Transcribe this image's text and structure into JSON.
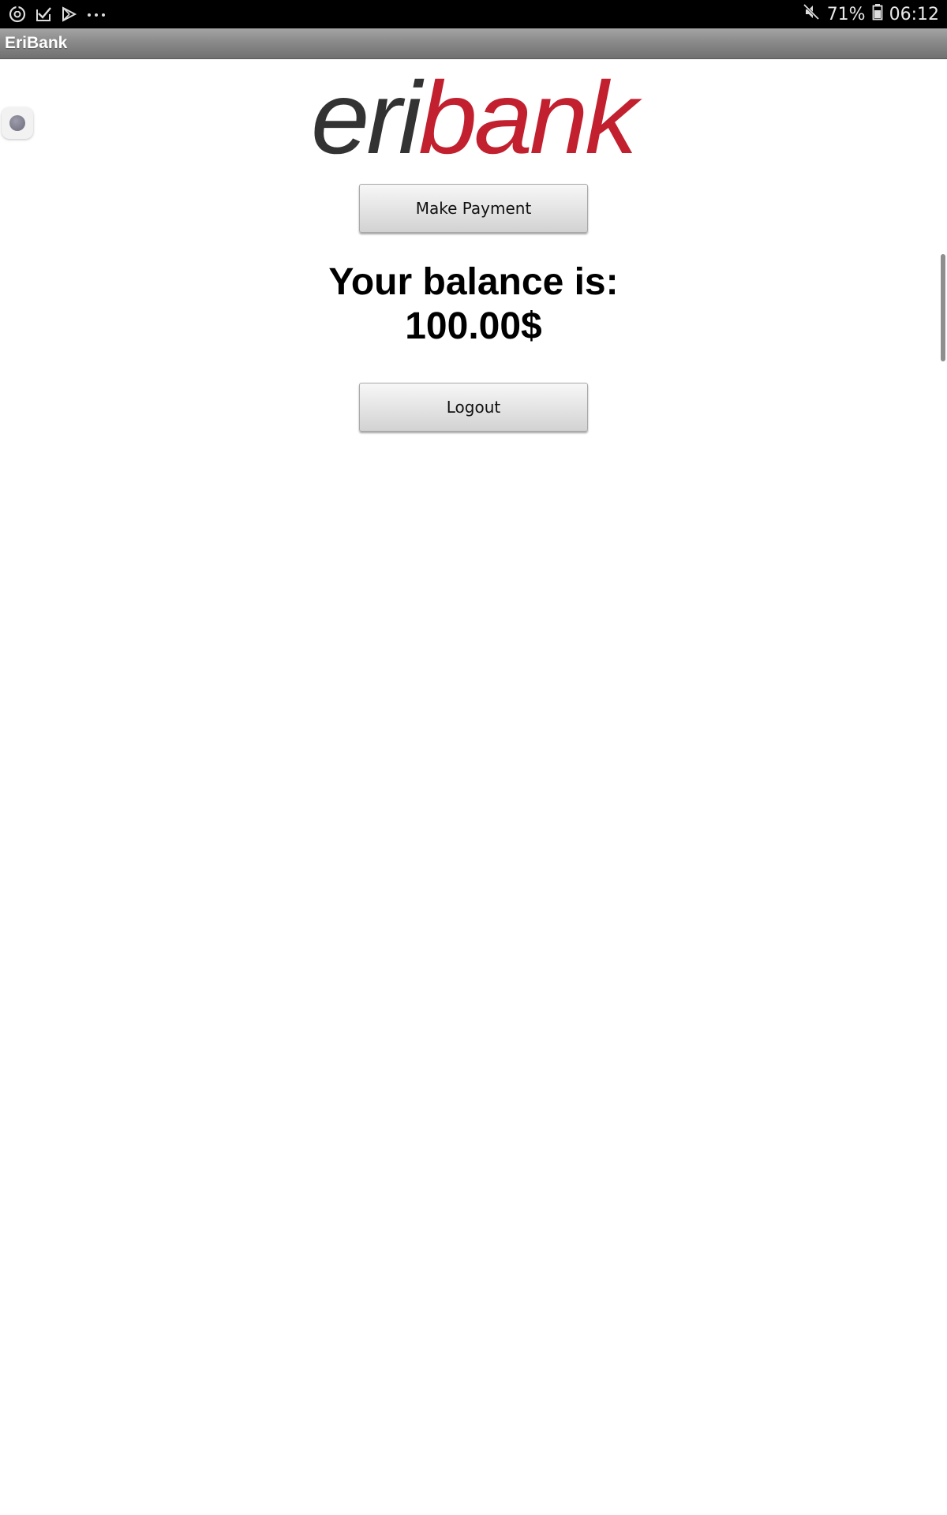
{
  "status_bar": {
    "icons": [
      "sync-icon",
      "mail-check-icon",
      "play-store-icon",
      "more-dots-icon"
    ],
    "mute_icon": "mute-icon",
    "battery_icon": "battery-icon",
    "battery": "71%",
    "time": "06:12"
  },
  "app": {
    "title": "EriBank"
  },
  "logo": {
    "text_dark": "eri",
    "text_red": "bank",
    "dark_color": "#333333",
    "red_color": "#c2202f"
  },
  "actions": {
    "make_payment": "Make Payment",
    "logout": "Logout"
  },
  "balance": {
    "label": "Your balance is:",
    "amount": "100.00$"
  }
}
